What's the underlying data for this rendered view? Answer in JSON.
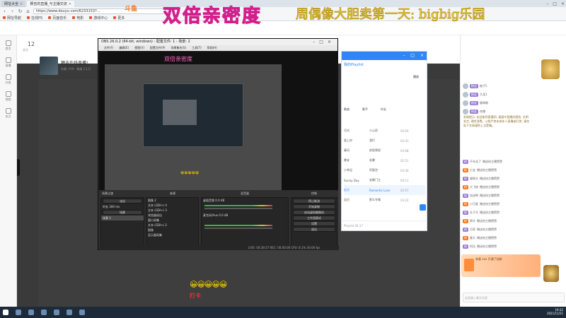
{
  "browser": {
    "tabs": [
      {
        "label": "网址大全",
        "active": false
      },
      {
        "label": "狮吉的直播_与主播交流",
        "active": true
      }
    ],
    "url": "https://www.douyu.com/6233153?...",
    "bookmarks": [
      "网址导航",
      "在线PS",
      "页面音乐",
      "电影",
      "游戏中心",
      "更多"
    ]
  },
  "watermark": {
    "main": "双倍亲密度",
    "side": "周偶像大胆卖第一天: bigbig乐园",
    "small": "双倍亲密度"
  },
  "douyu": {
    "logo": "斗鱼",
    "room_num": "12",
    "room_sub": "关注",
    "room_title": "狮吉在线直播!",
    "room_meta": "分类: 户外 · 热度 2.1万",
    "rail": [
      "首页",
      "直播",
      "分类",
      "视频",
      "关注"
    ]
  },
  "chat": {
    "rows": [
      {
        "badge": "粉丝",
        "text": "柚子5"
      },
      {
        "badge": "粉丝",
        "text": "大龙1"
      },
      {
        "badge": "粉丝",
        "text": "猫咪粮"
      },
      {
        "badge": "粉丝",
        "text": "吃播"
      }
    ],
    "long_message": "系统提示: 欢迎来到直播间, 请遵守直播间规则, 文明发言, 理性消费。斗鱼严禁未成年人直播或打赏, 请勿私下交易谨防上当受骗。",
    "gifts": [
      {
        "name": "不辛苦了",
        "text": "赠送给主播赞赞"
      },
      {
        "name": "七宝",
        "text": "赠送给主播赞赞"
      },
      {
        "name": "猫咪头",
        "text": "赠送给主播赞赞"
      },
      {
        "name": "大飞侠",
        "text": "赠送给主播赞赞"
      },
      {
        "name": "加油鸭",
        "text": "赠送给主播赞赞"
      },
      {
        "name": "小可爱",
        "text": "赠送给主播赞赞"
      },
      {
        "name": "丸子头",
        "text": "赠送给主播赞赞"
      },
      {
        "name": "绵羊",
        "text": "赠送给主播赞赞"
      },
      {
        "name": "月亮",
        "text": "赠送给主播赞赞"
      },
      {
        "name": "春天",
        "text": "赠送给主播赞赞"
      },
      {
        "name": "阿达",
        "text": "赠送给主播赞赞"
      }
    ],
    "gift_banner": "恭喜 xxx 开通了钻粉",
    "input_placeholder": "这里输入聊天内容"
  },
  "obs": {
    "title": "OBS 26.0.2 (64-bit, windows) - 配置文件: 1 - 场景: 2",
    "menu": [
      "文件(F)",
      "编辑(E)",
      "视图(V)",
      "配置文件(P)",
      "场景集合(S)",
      "工具(T)",
      "帮助(H)"
    ],
    "docks": {
      "scenes_title": "场景过渡",
      "sources_title": "来源",
      "mixer_title": "混音器",
      "controls_title": "控制"
    },
    "transition": "淡出",
    "duration_label": "时长",
    "duration": "300 ms",
    "scene_btn": "场景",
    "scene_item": "场景 2",
    "sources": [
      "图像 2",
      "文本 (GDI+) 4",
      "文本 (GDI+) 3",
      "浏览器退出",
      "窗口采集",
      "文本 (GDI+) 2",
      "图像",
      "显示器采集"
    ],
    "mixer": [
      {
        "name": "桌面音频",
        "db": "0.0 dB"
      },
      {
        "name": "麦克风/Aux",
        "db": "0.0 dB"
      }
    ],
    "controls": [
      "停止推流",
      "开始录制",
      "启动虚拟摄像机",
      "工作室模式",
      "设置",
      "退出"
    ],
    "status": "LIVE: 00:28:37  REC: 00:00:00  CPU: 8.1%  30.00 fps"
  },
  "music": {
    "tab": "我的Playlist",
    "side": "播放",
    "header": [
      "歌曲",
      "歌手",
      "时长"
    ],
    "songs": [
      {
        "title": "月光",
        "artist": "小心愿",
        "dur": "03:05",
        "playing": false
      },
      {
        "title": "爱上你",
        "artist": "我们",
        "dur": "03:41",
        "playing": false
      },
      {
        "title": "春风",
        "artist": "前程锦程",
        "dur": "03:08",
        "playing": false
      },
      {
        "title": "晚安",
        "artist": "若霖",
        "dur": "02:51",
        "playing": false
      },
      {
        "title": "小幸运",
        "artist": "阿星宫",
        "dur": "03:30",
        "playing": false
      },
      {
        "title": "Sunny Day",
        "artist": "安静门主",
        "dur": "04:11",
        "playing": false
      },
      {
        "title": "远方",
        "artist": "Romantic Love",
        "dur": "03:57",
        "playing": true
      },
      {
        "title": "告白",
        "artist": "那么专情",
        "dur": "03:22",
        "playing": false
      }
    ],
    "footer": "Playlist 04:17"
  },
  "emojis": {
    "small": "😀😀😀😀😀",
    "big": "😀😀😀😀😀",
    "red": "打卡"
  },
  "taskbar": {
    "time": "19:32",
    "date": "2021/11/21"
  },
  "colors": {
    "watermark_pink": "#ff69c8",
    "watermark_yellow": "#ffe73a",
    "douyu_orange": "#f7751e",
    "music_blue": "#2f86f6"
  }
}
